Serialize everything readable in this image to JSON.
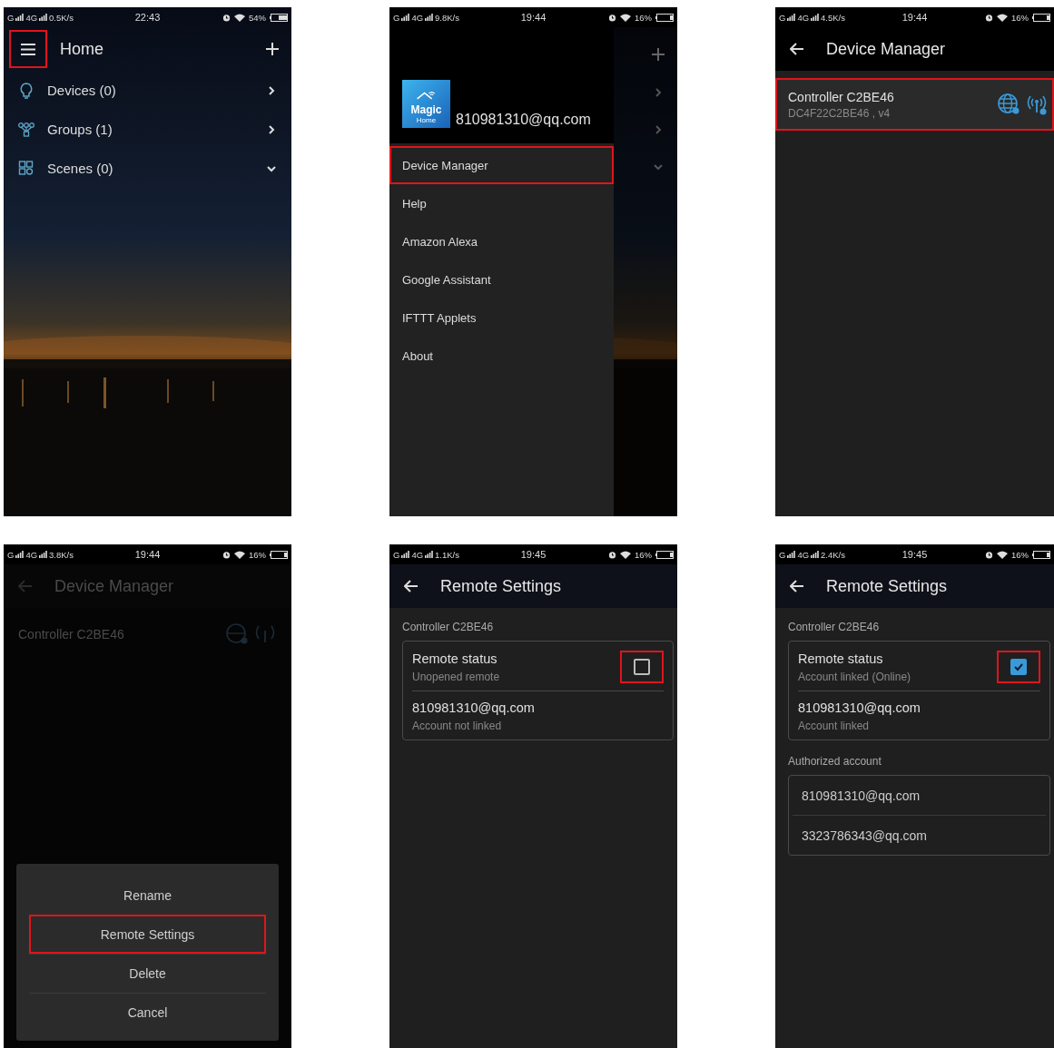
{
  "screens": [
    {
      "kind": "home",
      "status": {
        "sim1": "G",
        "sim2": "4G",
        "speed": "0.5K/s",
        "time": "22:43",
        "battery": "54%"
      },
      "title": "Home",
      "menu_highlighted": true,
      "items": [
        {
          "kind": "bulb",
          "label": "Devices (0)",
          "expanded": false
        },
        {
          "kind": "groups",
          "label": "Groups (1)",
          "expanded": false
        },
        {
          "kind": "scenes",
          "label": "Scenes (0)",
          "expanded": true
        }
      ]
    },
    {
      "kind": "drawer",
      "status": {
        "sim1": "G",
        "sim2": "4G",
        "speed": "9.8K/s",
        "time": "19:44",
        "battery": "16%"
      },
      "logo": {
        "line1": "Magic",
        "line2": "Home"
      },
      "account": "810981310@qq.com",
      "menu": [
        {
          "label": "Device Manager",
          "highlighted": true
        },
        {
          "label": "Help",
          "highlighted": false
        },
        {
          "label": "Amazon Alexa",
          "highlighted": false
        },
        {
          "label": "Google Assistant",
          "highlighted": false
        },
        {
          "label": "IFTTT Applets",
          "highlighted": false
        },
        {
          "label": "About",
          "highlighted": false
        }
      ],
      "behind": [
        {
          "expanded": false
        },
        {
          "expanded": false
        },
        {
          "expanded": true
        }
      ]
    },
    {
      "kind": "device_manager",
      "status": {
        "sim1": "G",
        "sim2": "4G",
        "speed": "4.5K/s",
        "time": "19:44",
        "battery": "16%"
      },
      "title": "Device Manager",
      "devices": [
        {
          "name": "Controller  C2BE46",
          "detail": "DC4F22C2BE46 , v4",
          "highlighted": true
        }
      ]
    },
    {
      "kind": "action_sheet",
      "status": {
        "sim1": "G",
        "sim2": "4G",
        "speed": "3.8K/s",
        "time": "19:44",
        "battery": "16%"
      },
      "title": "Device Manager",
      "device": "Controller  C2BE46",
      "actions": [
        {
          "label": "Rename",
          "highlighted": false
        },
        {
          "label": "Remote Settings",
          "highlighted": true
        },
        {
          "label": "Delete",
          "highlighted": false
        },
        {
          "label": "Cancel",
          "highlighted": false
        }
      ]
    },
    {
      "kind": "remote_settings",
      "status": {
        "sim1": "G",
        "sim2": "4G",
        "speed": "1.1K/s",
        "time": "19:45",
        "battery": "16%"
      },
      "title": "Remote Settings",
      "device": "Controller  C2BE46",
      "remote": {
        "label": "Remote status",
        "text": "Unopened remote",
        "checked": false,
        "highlighted": true
      },
      "account": {
        "email": "810981310@qq.com",
        "text": "Account not linked"
      }
    },
    {
      "kind": "remote_settings",
      "status": {
        "sim1": "G",
        "sim2": "4G",
        "speed": "2.4K/s",
        "time": "19:45",
        "battery": "16%"
      },
      "title": "Remote Settings",
      "device": "Controller  C2BE46",
      "remote": {
        "label": "Remote status",
        "text": "Account linked (Online)",
        "checked": true,
        "highlighted": true
      },
      "account": {
        "email": "810981310@qq.com",
        "text": "Account linked"
      },
      "authorized": {
        "heading": "Authorized account",
        "accounts": [
          "810981310@qq.com",
          "3323786343@qq.com"
        ]
      }
    }
  ]
}
